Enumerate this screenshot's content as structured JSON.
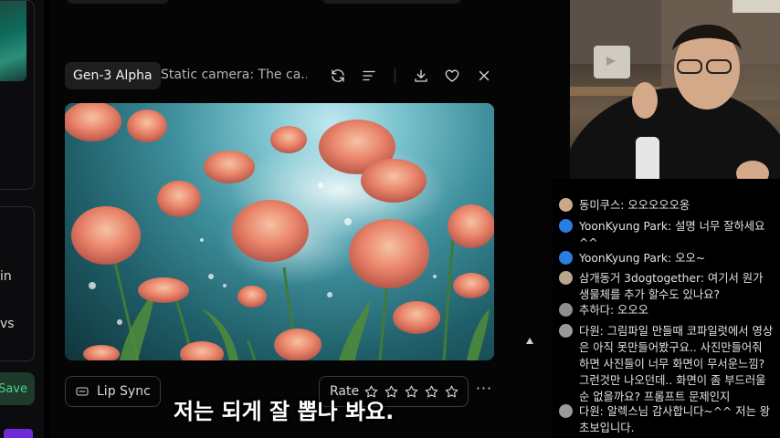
{
  "sidebar": {
    "frag_texts": [
      "in",
      "vs"
    ],
    "save_label": "Save"
  },
  "toolbar": {
    "model_tag": "Gen-3 Alpha",
    "prompt_preview": "Static camera: The ca...",
    "icons": [
      "refresh-icon",
      "menu-lines-icon",
      "download-icon",
      "heart-icon",
      "close-icon"
    ]
  },
  "video": {
    "description_colors": {
      "water": "#3e8f9c",
      "flower": "#e9846a"
    }
  },
  "actions": {
    "lip_sync_label": "Lip Sync",
    "rate_label": "Rate",
    "rating": {
      "value": 0,
      "max": 5
    },
    "more_label": "···"
  },
  "subtitle": "저는 되게 잘 뽑나 봐요.",
  "chat": {
    "messages": [
      {
        "name": "동미쿠스:",
        "text": "오오오오오옹",
        "avatar": "#c9a98a"
      },
      {
        "name": "YoonKyung Park:",
        "text": "설명 너무 잘하세요 ^^",
        "avatar": "#2a7de1"
      },
      {
        "name": "YoonKyung Park:",
        "text": "오오~",
        "avatar": "#2a7de1"
      },
      {
        "name": "삼개동거 3dogtogether:",
        "text": "여기서 원가 생물체를 추가 할수도 있나요?",
        "avatar": "#b9a58e"
      },
      {
        "name": "추하다:",
        "text": "오오오",
        "avatar": "#8f8f8f"
      },
      {
        "name": "다원:",
        "text": "그림파일 만들때 코파일럿에서 영상은 아직 못만들어봤구요.. 사진만들어줘 하면 사진들이 너무 화면이 무서운느낌? 그런것만 나오던데.. 화면이 좀 부드러울 순 없을까요? 프롬프트 문제인지",
        "avatar": "#9a9a9a"
      },
      {
        "name": "다원:",
        "text": "알렉스님 감사합니다~^^ 저는 왕초보입니다.",
        "avatar": "#9a9a9a"
      }
    ]
  }
}
